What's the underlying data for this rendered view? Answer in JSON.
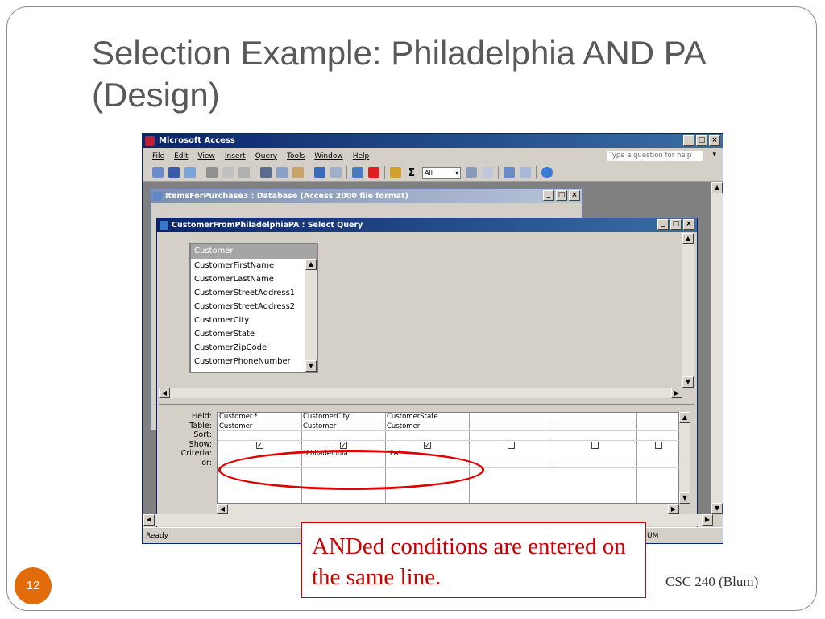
{
  "slide": {
    "title": "Selection Example: Philadelphia AND PA (Design)",
    "number": "12",
    "footer": "CSC 240 (Blum)",
    "callout": "ANDed conditions are entered on the same line."
  },
  "app": {
    "title": "Microsoft Access",
    "menu": [
      "File",
      "Edit",
      "View",
      "Insert",
      "Query",
      "Tools",
      "Window",
      "Help"
    ],
    "help_placeholder": "Type a question for help",
    "toolbar_select": "All",
    "status": "Ready",
    "status_num": "UM"
  },
  "db_window": {
    "title": "ItemsForPurchase3 : Database (Access 2000 file format)"
  },
  "query_window": {
    "title": "CustomerFromPhiladelphiaPA : Select Query",
    "field_list": {
      "header": "Customer",
      "items": [
        "CustomerFirstName",
        "CustomerLastName",
        "CustomerStreetAddress1",
        "CustomerStreetAddress2",
        "CustomerCity",
        "CustomerState",
        "CustomerZipCode",
        "CustomerPhoneNumber"
      ]
    },
    "row_labels": [
      "Field:",
      "Table:",
      "Sort:",
      "Show:",
      "Criteria:",
      "or:"
    ],
    "columns": [
      {
        "field": "Customer.*",
        "table": "Customer",
        "show": true,
        "criteria": ""
      },
      {
        "field": "CustomerCity",
        "table": "Customer",
        "show": true,
        "criteria": "\"Philadelphia\""
      },
      {
        "field": "CustomerState",
        "table": "Customer",
        "show": true,
        "criteria": "\"PA\""
      },
      {
        "field": "",
        "table": "",
        "show": false,
        "criteria": ""
      },
      {
        "field": "",
        "table": "",
        "show": false,
        "criteria": ""
      },
      {
        "field": "",
        "table": "",
        "show": false,
        "criteria": ""
      }
    ]
  },
  "colors": {
    "title_gray": "#595959",
    "accent_orange": "#e36c0a",
    "callout_red": "#cc0000",
    "xp_blue": "#0a246a"
  }
}
